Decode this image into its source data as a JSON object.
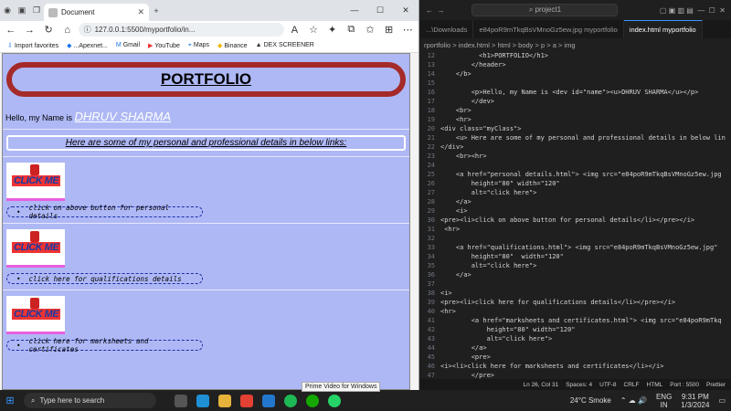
{
  "browser": {
    "tab_title": "Document",
    "url": "127.0.0.1:5500/myportfolio/in...",
    "bookmarks": [
      "Import favorites",
      "...Apexnet...",
      "Gmail",
      "YouTube",
      "Maps",
      "Binance",
      "DEX SCREENER"
    ],
    "tooltip": "Prime Video for Windows"
  },
  "page": {
    "title": "PORTFOLIO",
    "greeting": "Hello, my Name is",
    "name": "DHRUV SHARMA",
    "details_heading": "Here are some of my personal and professional details in below links:",
    "img_alt": "CLICK ME",
    "items": [
      {
        "label": "click on above button for personal details"
      },
      {
        "label": "click here for qualifications details"
      },
      {
        "label": "click here for marksheets and certificates"
      }
    ]
  },
  "editor": {
    "search": "project1",
    "tabs": [
      "...\\Downloads",
      "e84poR9mTkqBsVMnoGz5ew.jpg  myportfolio",
      "index.html  myportfolio"
    ],
    "breadcrumb": "rportfolio > index.html > html > body > p > a > img",
    "code_lines": [
      {
        "n": "12",
        "txt": "          <h1>PORTFOLIO</h1>"
      },
      {
        "n": "13",
        "txt": "        </header>"
      },
      {
        "n": "14",
        "txt": "    </b>"
      },
      {
        "n": "15",
        "txt": ""
      },
      {
        "n": "16",
        "txt": "        <p>Hello, my Name is <dev id=\"name\"><u>DHRUV SHARMA</u></p>"
      },
      {
        "n": "17",
        "txt": "        </dev>"
      },
      {
        "n": "18",
        "txt": "    <br>"
      },
      {
        "n": "19",
        "txt": "    <hr>"
      },
      {
        "n": "20",
        "txt": "<div class=\"myClass\">"
      },
      {
        "n": "21",
        "txt": "    <u> Here are some of my personal and professional details in below lin"
      },
      {
        "n": "22",
        "txt": "</div>"
      },
      {
        "n": "23",
        "txt": "    <br><hr>"
      },
      {
        "n": "24",
        "txt": ""
      },
      {
        "n": "25",
        "txt": "    <a href=\"personal details.html\"> <img src=\"e84poR9mTkqBsVMnoGz5ew.jpg"
      },
      {
        "n": "26",
        "txt": "        height=\"80\" width=\"120\""
      },
      {
        "n": "27",
        "txt": "        alt=\"click here\">"
      },
      {
        "n": "28",
        "txt": "    </a>"
      },
      {
        "n": "29",
        "txt": "    <i>"
      },
      {
        "n": "30",
        "txt": "<pre><li>click on above button for personal details</li></pre></i>"
      },
      {
        "n": "31",
        "txt": " <hr>"
      },
      {
        "n": "32",
        "txt": ""
      },
      {
        "n": "33",
        "txt": "    <a href=\"qualifications.html\"> <img src=\"e84poR9mTkqBsVMnoGz5ew.jpg\""
      },
      {
        "n": "34",
        "txt": "        height=\"80\"  width=\"120\""
      },
      {
        "n": "35",
        "txt": "        alt=\"click here\">"
      },
      {
        "n": "36",
        "txt": "    </a>"
      },
      {
        "n": "37",
        "txt": ""
      },
      {
        "n": "38",
        "txt": "<i>"
      },
      {
        "n": "39",
        "txt": "<pre><li>click here for qualifications details</li></pre></i>"
      },
      {
        "n": "40",
        "txt": "<hr>"
      },
      {
        "n": "41",
        "txt": "        <a href=\"marksheets and certificates.html\"> <img src=\"e84poR9mTkq"
      },
      {
        "n": "42",
        "txt": "            height=\"80\" width=\"120\""
      },
      {
        "n": "43",
        "txt": "            alt=\"click here\">"
      },
      {
        "n": "44",
        "txt": "        </a>"
      },
      {
        "n": "45",
        "txt": "        <pre>"
      },
      {
        "n": "46",
        "txt": "<i><li>click here for marksheets and certificates</li></i>"
      },
      {
        "n": "47",
        "txt": "        </pre>"
      }
    ],
    "status": [
      "Ln 26, Col 31",
      "Spaces: 4",
      "UTF-8",
      "CRLF",
      "HTML",
      "Port : 5500",
      "Prettier"
    ]
  },
  "taskbar": {
    "search_placeholder": "Type here to search",
    "weather": "24°C  Smoke",
    "lang": "ENG",
    "region": "IN",
    "time": "9:31 PM",
    "date": "1/3/2024"
  }
}
